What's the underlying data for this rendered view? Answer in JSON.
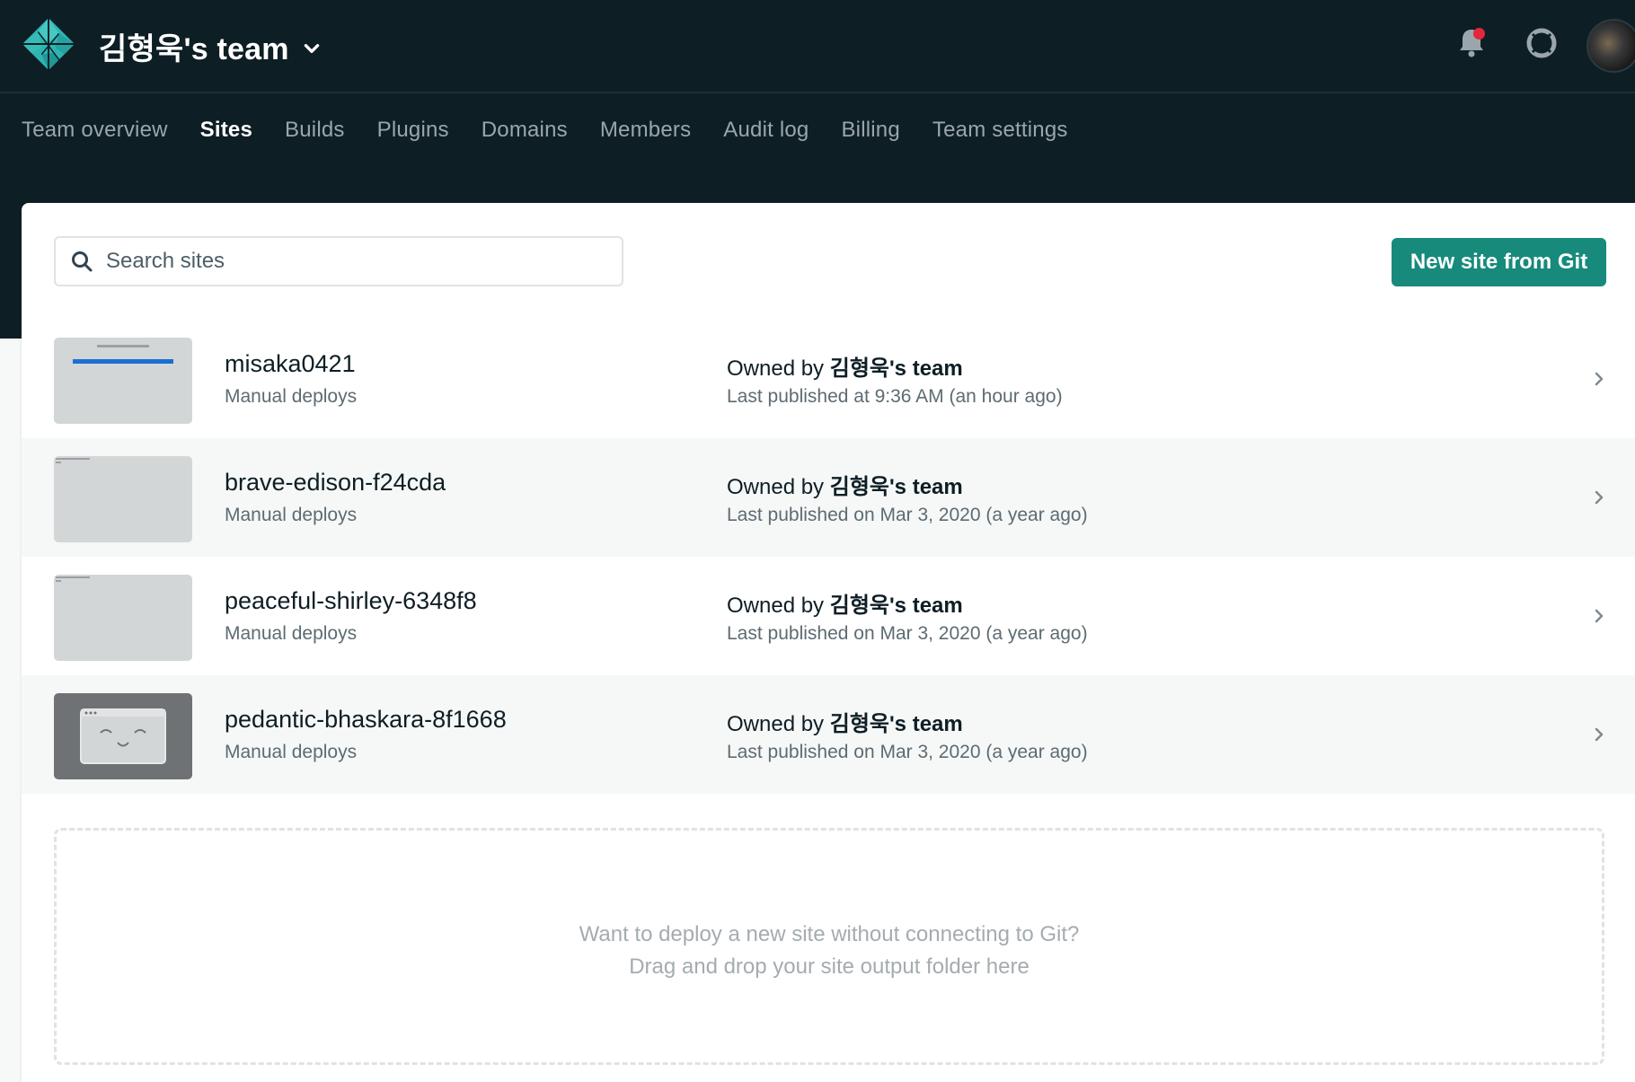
{
  "header": {
    "team_name": "김형욱's team",
    "notifications_unread": true,
    "accent_color": "#178a7c"
  },
  "nav": {
    "tabs": [
      {
        "label": "Team overview",
        "active": false
      },
      {
        "label": "Sites",
        "active": true
      },
      {
        "label": "Builds",
        "active": false
      },
      {
        "label": "Plugins",
        "active": false
      },
      {
        "label": "Domains",
        "active": false
      },
      {
        "label": "Members",
        "active": false
      },
      {
        "label": "Audit log",
        "active": false
      },
      {
        "label": "Billing",
        "active": false
      },
      {
        "label": "Team settings",
        "active": false
      }
    ]
  },
  "search": {
    "placeholder": "Search sites",
    "value": ""
  },
  "toolbar": {
    "new_site_label": "New site from Git"
  },
  "sites": [
    {
      "name": "misaka0421",
      "deploy_type": "Manual deploys",
      "owner_prefix": "Owned by ",
      "owner_team": "김형욱's team",
      "published": "Last published at 9:36 AM (an hour ago)",
      "thumb": "blue-bar"
    },
    {
      "name": "brave-edison-f24cda",
      "deploy_type": "Manual deploys",
      "owner_prefix": "Owned by ",
      "owner_team": "김형욱's team",
      "published": "Last published on Mar 3, 2020 (a year ago)",
      "thumb": "blank"
    },
    {
      "name": "peaceful-shirley-6348f8",
      "deploy_type": "Manual deploys",
      "owner_prefix": "Owned by ",
      "owner_team": "김형욱's team",
      "published": "Last published on Mar 3, 2020 (a year ago)",
      "thumb": "blank"
    },
    {
      "name": "pedantic-bhaskara-8f1668",
      "deploy_type": "Manual deploys",
      "owner_prefix": "Owned by ",
      "owner_team": "김형욱's team",
      "published": "Last published on Mar 3, 2020 (a year ago)",
      "thumb": "placeholder-face"
    }
  ],
  "dropzone": {
    "line1": "Want to deploy a new site without connecting to Git?",
    "line2": "Drag and drop your site output folder here"
  }
}
